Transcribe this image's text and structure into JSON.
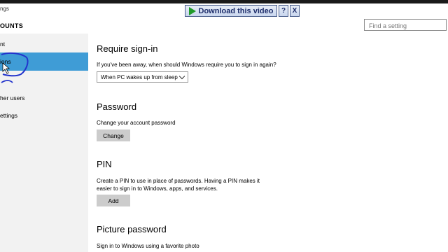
{
  "window": {
    "app_title": "ngs"
  },
  "overlay": {
    "download_label": "Download this video",
    "help_label": "?",
    "close_label": "X"
  },
  "header": {
    "section_title": "OUNTS",
    "search_placeholder": "Find a setting"
  },
  "sidebar": {
    "items": [
      {
        "label": "nt"
      },
      {
        "label": "ions"
      },
      {
        "label": ""
      },
      {
        "label": "her users"
      },
      {
        "label": "ettings"
      }
    ]
  },
  "sections": {
    "signin": {
      "title": "Require sign-in",
      "description": "If you've been away, when should Windows require you to sign in again?",
      "dropdown_value": "When PC wakes up from sleep"
    },
    "password": {
      "title": "Password",
      "description": "Change your account password",
      "button_label": "Change"
    },
    "pin": {
      "title": "PIN",
      "description_line1": "Create a PIN to use in place of passwords. Having a PIN makes it",
      "description_line2": "easier to sign in to Windows, apps, and services.",
      "button_label": "Add"
    },
    "picture_password": {
      "title": "Picture password",
      "description": "Sign in to Windows using a favorite photo"
    }
  },
  "colors": {
    "accent": "#3f9cd6",
    "sidebar_bg": "#f2f2f2",
    "button_bg": "#cccccc",
    "annotation": "#2233cc"
  }
}
